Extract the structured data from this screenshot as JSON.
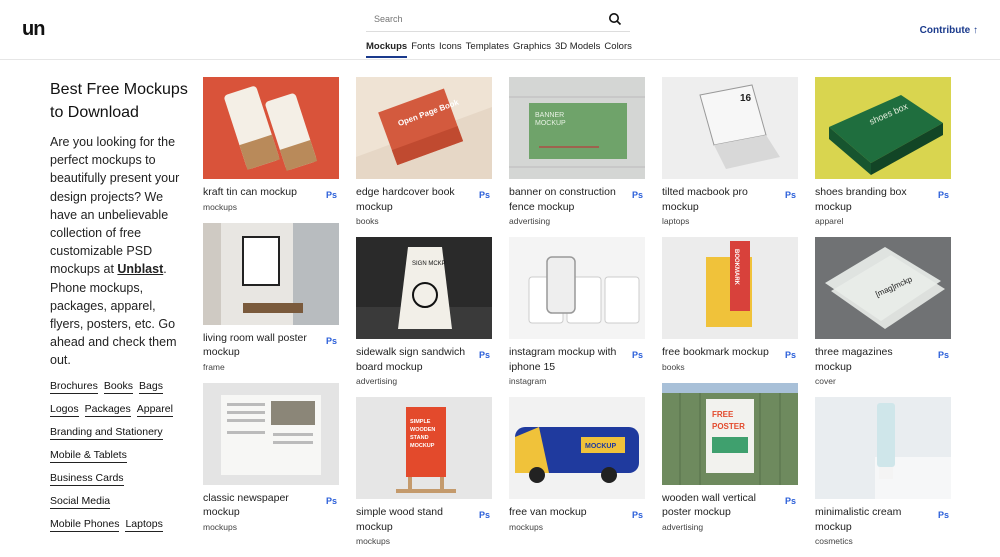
{
  "header": {
    "logo": "un",
    "search_placeholder": "Search",
    "nav": [
      "Mockups",
      "Fonts",
      "Icons",
      "Templates",
      "Graphics",
      "3D Models",
      "Colors"
    ],
    "active_nav": "Mockups",
    "contribute": "Contribute ↑"
  },
  "sidebar": {
    "title_line1": "Best Free Mockups",
    "title_line2": "to Download",
    "intro_before": "Are you looking for the perfect mockups to beautifully present your design projects? We have an unbelievable collection of free customizable PSD mockups at ",
    "intro_link": "Unblast",
    "intro_after": ". Phone mockups, packages, apparel, flyers, posters, etc. Go ahead and check them out.",
    "tag_rows": [
      [
        "Brochures",
        "Books",
        "Bags"
      ],
      [
        "Logos",
        "Packages",
        "Apparel"
      ],
      [
        "Branding and Stationery"
      ],
      [
        "Mobile & Tablets"
      ],
      [
        "Business Cards"
      ],
      [
        "Social Media"
      ],
      [
        "Mobile Phones",
        "Laptops"
      ]
    ]
  },
  "ps_label": "Ps",
  "columns": [
    [
      {
        "title": "kraft tin can mockup",
        "category": "mockups",
        "thumb": "tin"
      },
      {
        "title": "living room wall poster mockup",
        "category": "frame",
        "thumb": "room"
      },
      {
        "title": "classic newspaper mockup",
        "category": "mockups",
        "thumb": "newspaper"
      }
    ],
    [
      {
        "title": "edge hardcover book mockup",
        "category": "books",
        "thumb": "book"
      },
      {
        "title": "sidewalk sign sandwich board mockup",
        "category": "advertising",
        "thumb": "sign"
      },
      {
        "title": "simple wood stand mockup",
        "category": "mockups",
        "thumb": "stand"
      }
    ],
    [
      {
        "title": "banner on construction fence mockup",
        "category": "advertising",
        "thumb": "banner"
      },
      {
        "title": "instagram mockup with iphone 15",
        "category": "instagram",
        "thumb": "instagram"
      },
      {
        "title": "free van mockup",
        "category": "mockups",
        "thumb": "van"
      }
    ],
    [
      {
        "title": "tilted macbook pro mockup",
        "category": "laptops",
        "thumb": "macbook"
      },
      {
        "title": "free bookmark mockup",
        "category": "books",
        "thumb": "bookmark"
      },
      {
        "title": "wooden wall vertical poster mockup",
        "category": "advertising",
        "thumb": "wallposter"
      }
    ],
    [
      {
        "title": "shoes branding box mockup",
        "category": "apparel",
        "thumb": "shoebox"
      },
      {
        "title": "three magazines mockup",
        "category": "cover",
        "thumb": "magazines"
      },
      {
        "title": "minimalistic cream mockup",
        "category": "cosmetics",
        "thumb": "cream"
      }
    ]
  ],
  "thumb_text": {
    "banner": "BANNER\nMOCKUP",
    "book": "Open Page Book",
    "macbook": "16",
    "shoebox": "shoes box",
    "sign": "SIGN MCKP",
    "bookmark": "BOOKMARK",
    "magazines": "[mag]mckp",
    "stand": "SIMPLE WOODEN STAND MOCKUP",
    "van": "MOCKUP",
    "wallposter": "FREE POSTER"
  },
  "colors": {
    "accent": "#1a3a8c",
    "ps": "#2b5fd9"
  }
}
